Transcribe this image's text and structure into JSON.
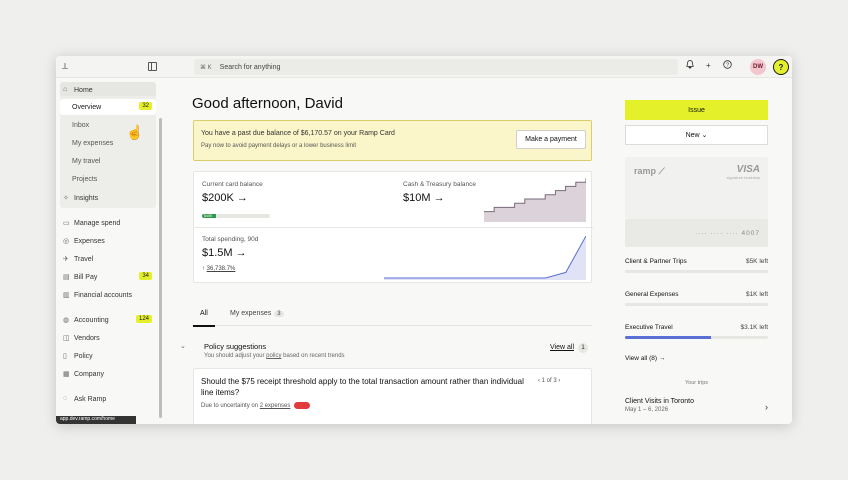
{
  "topbar": {
    "search_kbd": "⌘ K",
    "search_placeholder": "Search for anything",
    "avatar_initials": "DW",
    "help_glyph": "?",
    "bell_glyph": "🔔",
    "plus_glyph": "+",
    "question_glyph": "ⓘ",
    "logo_glyph": "⟂"
  },
  "sidebar": {
    "home": "Home",
    "sub_items": [
      {
        "label": "Overview",
        "badge": "32"
      },
      {
        "label": "Inbox"
      },
      {
        "label": "My expenses"
      },
      {
        "label": "My travel"
      },
      {
        "label": "Projects"
      }
    ],
    "items": [
      {
        "label": "Insights"
      },
      {
        "label": "Manage spend"
      },
      {
        "label": "Expenses"
      },
      {
        "label": "Travel"
      },
      {
        "label": "Bill Pay",
        "badge": "34"
      },
      {
        "label": "Financial accounts"
      },
      {
        "label": "Accounting",
        "badge": "124"
      },
      {
        "label": "Vendors"
      },
      {
        "label": "Policy"
      },
      {
        "label": "Company"
      },
      {
        "label": "Ask Ramp"
      }
    ],
    "tooltip": "app.dev.ramp.com/home"
  },
  "main": {
    "greeting": "Good afternoon, David",
    "alert": {
      "line1": "You have a past due balance of $6,170.57 on your Ramp Card",
      "line2": "Pay now to avoid payment delays or a lower business limit",
      "button": "Make a payment"
    },
    "stats": {
      "card_balance_label": "Current card balance",
      "card_balance_value": "$200K →",
      "card_balance_progress": 0.2,
      "card_balance_progress_label": "$40K",
      "treasury_label": "Cash & Treasury balance",
      "treasury_value": "$10M →",
      "spending_label": "Total spending, 90d",
      "spending_value": "$1.5M →",
      "spending_change": "↑ ",
      "spending_change_value": "36,738.7%"
    },
    "tabs": [
      {
        "label": "All"
      },
      {
        "label": "My expenses",
        "count": "3"
      }
    ],
    "policy": {
      "chevron": "⌄",
      "title": "Policy suggestions",
      "subtitle_pre": "You should adjust your ",
      "subtitle_link": "policy",
      "subtitle_post": " based on recent trends",
      "view_all": "View all",
      "view_all_count": "1"
    },
    "suggestion": {
      "question": "Should the $75 receipt threshold apply to the total transaction amount rather than individual line items?",
      "pager": "‹   1 of 3   ›",
      "reason_pre": "Due to uncertainty on ",
      "reason_link": "2 expenses"
    }
  },
  "right_panel": {
    "issue_button": "Issue",
    "new_button": "New ⌄",
    "card_brand": "ramp ⟋",
    "card_network": "VISA",
    "card_network_sub": "signature business",
    "card_number": "···· ···· ···· 4007",
    "limits": [
      {
        "name": "Client & Partner Trips",
        "value": "$5K left",
        "fraction": 0.0
      },
      {
        "name": "General Expenses",
        "value": "$1K left",
        "fraction": 0.0
      },
      {
        "name": "Executive Travel",
        "value": "$3.1K left",
        "fraction": 0.6
      }
    ],
    "view_all": "View all (8) →",
    "trips_heading": "Your trips",
    "trip": {
      "name": "Client Visits in Toronto",
      "dates": "May 1 – 6, 2026",
      "chevron": "›"
    }
  },
  "chart_data": [
    {
      "type": "area",
      "description_series": "treasury balance trend",
      "values": [
        2,
        3,
        3,
        4,
        5,
        5,
        6,
        7,
        8,
        9,
        10
      ]
    },
    {
      "type": "area",
      "description_series": "spending trend",
      "values": [
        0,
        0,
        0,
        0,
        0,
        0,
        0,
        0,
        0,
        0.2,
        1.5
      ]
    }
  ],
  "colors": {
    "accent": "#e4f12a",
    "alert_bg": "#fbf6c9",
    "chart_stroke": "#7a6a78",
    "chart2_stroke": "#5a6fd6"
  }
}
